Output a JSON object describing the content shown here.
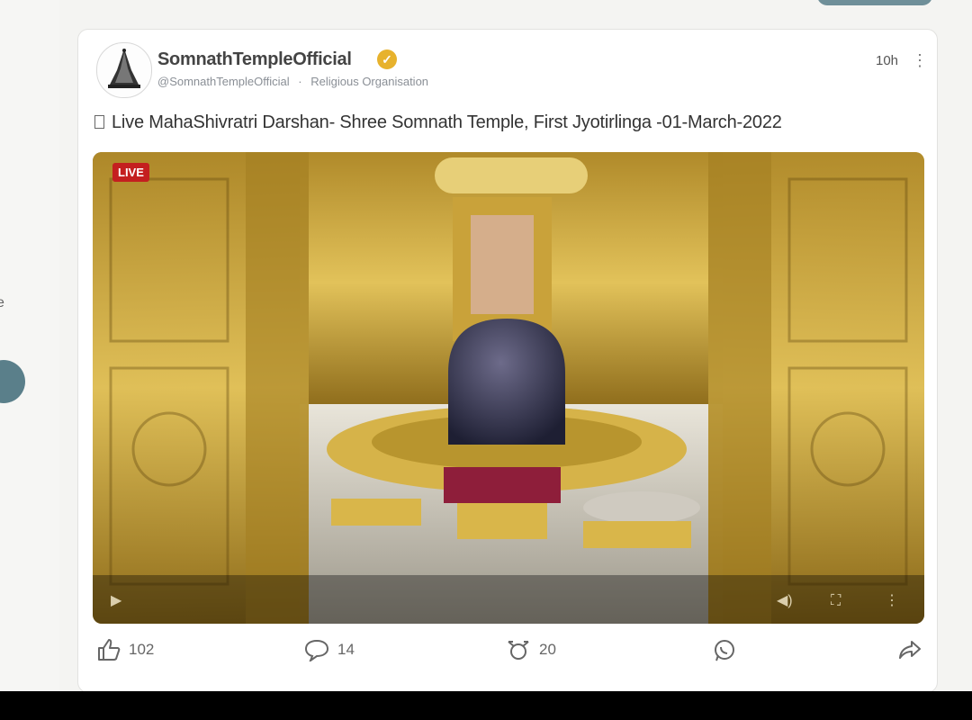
{
  "left_sidebar": {
    "text_fragment": "e"
  },
  "post": {
    "username": "SomnathTempleOfficial",
    "handle": "@SomnathTempleOfficial",
    "separator": "·",
    "category": "Religious Organisation",
    "time": "10h",
    "menu_icon": "more-vertical-icon",
    "caption": "Live MahaShivratri Darshan- Shree Somnath Temple, First Jyotirlinga -01-March-2022"
  },
  "video": {
    "live_badge": "LIVE"
  },
  "actions": {
    "likes": "102",
    "comments": "14",
    "reposts": "20",
    "like_icon": "thumbs-up-icon",
    "comment_icon": "comment-icon",
    "repost_icon": "repost-icon",
    "share_whatsapp_icon": "whatsapp-icon",
    "share_icon": "share-icon"
  },
  "colors": {
    "live": "#c41f1f",
    "verified": "#e7b22d",
    "gold": "#c9a032"
  }
}
